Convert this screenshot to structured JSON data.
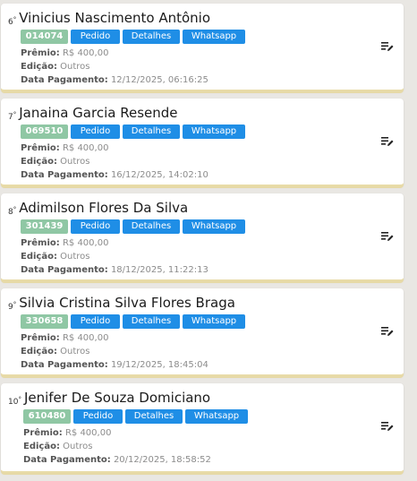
{
  "labels": {
    "pedido": "Pedido",
    "detalhes": "Detalhes",
    "whatsapp": "Whatsapp",
    "premio": "Prêmio:",
    "edicao": "Edição:",
    "data_pagamento": "Data Pagamento:"
  },
  "winners": [
    {
      "rank": "6",
      "name": "Vinicius Nascimento Antônio",
      "code": "014074",
      "premio": "R$ 400,00",
      "edicao": "Outros",
      "data": "12/12/2025, 06:16:25"
    },
    {
      "rank": "7",
      "name": "Janaina Garcia Resende",
      "code": "069510",
      "premio": "R$ 400,00",
      "edicao": "Outros",
      "data": "16/12/2025, 14:02:10"
    },
    {
      "rank": "8",
      "name": "Adimilson Flores Da Silva",
      "code": "301439",
      "premio": "R$ 400,00",
      "edicao": "Outros",
      "data": "18/12/2025, 11:22:13"
    },
    {
      "rank": "9",
      "name": "Silvia Cristina Silva Flores Braga",
      "code": "330658",
      "premio": "R$ 400,00",
      "edicao": "Outros",
      "data": "19/12/2025, 18:45:04"
    },
    {
      "rank": "10",
      "name": "Jenifer De Souza Domiciano",
      "code": "610480",
      "premio": "R$ 400,00",
      "edicao": "Outros",
      "data": "20/12/2025, 18:58:52"
    }
  ],
  "colors": {
    "badge": "#8fc7a4",
    "button": "#1f8ee6",
    "card_border": "#e8dba8"
  },
  "icon": "edit-list-icon"
}
